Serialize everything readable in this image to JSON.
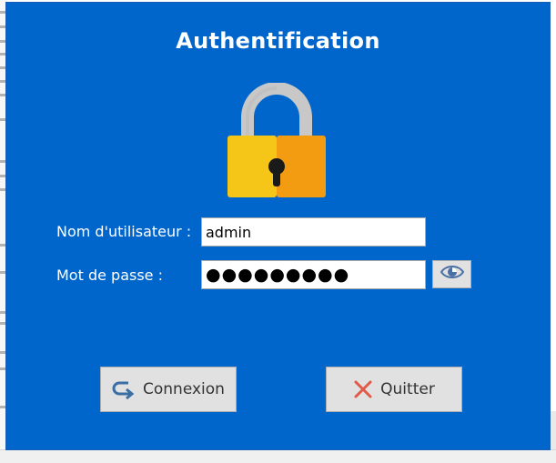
{
  "dialog": {
    "title": "Authentification",
    "background_color": "#0066CC"
  },
  "lock_icon": {
    "name": "padlock-icon",
    "colors": {
      "shackle": "#C8C8C8",
      "body_left": "#F5C518",
      "body_right": "#F39C12",
      "keyhole": "#1a1a1a"
    }
  },
  "form": {
    "username_label": "Nom d'utilisateur :",
    "username_value": "admin",
    "password_label": "Mot de passe :",
    "password_masked": "●●●●●●●●●",
    "show_password_icon": "eye-icon"
  },
  "buttons": {
    "connect_label": "Connexion",
    "connect_icon": "redo-arrow-icon",
    "connect_icon_color": "#3B6EA5",
    "quit_label": "Quitter",
    "quit_icon": "close-x-icon",
    "quit_icon_color": "#E05A47"
  }
}
